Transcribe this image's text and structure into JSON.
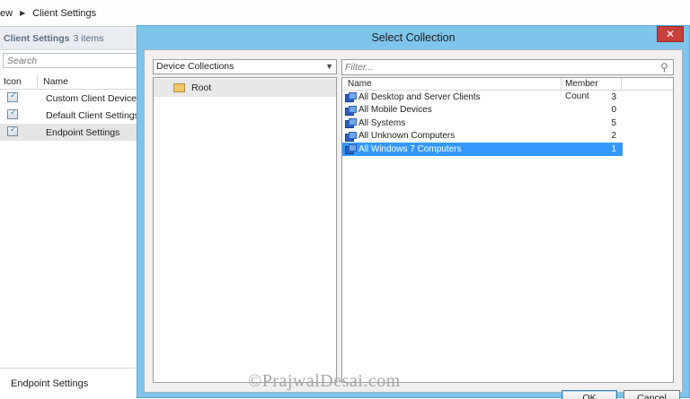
{
  "breadcrumb": {
    "prev": "ew",
    "current": "Client Settings"
  },
  "left_pane": {
    "title": "Client Settings",
    "count": "3 items",
    "search_placeholder": "Search",
    "columns": {
      "icon": "Icon",
      "name": "Name"
    },
    "rows": [
      {
        "name": "Custom Client Device S",
        "selected": false
      },
      {
        "name": "Default Client Settings",
        "selected": false
      },
      {
        "name": "Endpoint Settings",
        "selected": true
      }
    ],
    "bottom_title": "Endpoint Settings"
  },
  "dialog": {
    "title": "Select Collection",
    "close_label": "✕",
    "collection_type": "Device Collections",
    "tree": [
      {
        "label": "Root"
      }
    ],
    "filter_placeholder": "Filter...",
    "columns": {
      "name": "Name",
      "member_count": "Member Count"
    },
    "rows": [
      {
        "name": "All Desktop and Server Clients",
        "count": "3",
        "selected": false
      },
      {
        "name": "All Mobile Devices",
        "count": "0",
        "selected": false
      },
      {
        "name": "All Systems",
        "count": "5",
        "selected": false
      },
      {
        "name": "All Unknown Computers",
        "count": "2",
        "selected": false
      },
      {
        "name": "All Windows 7 Computers",
        "count": "1",
        "selected": true
      }
    ],
    "ok_label": "OK",
    "cancel_label": "Cancel"
  },
  "watermark": "©PrajwalDesai.com",
  "colors": {
    "accent": "#7fc4eb",
    "selection": "#3399ff",
    "close": "#c7403a"
  }
}
